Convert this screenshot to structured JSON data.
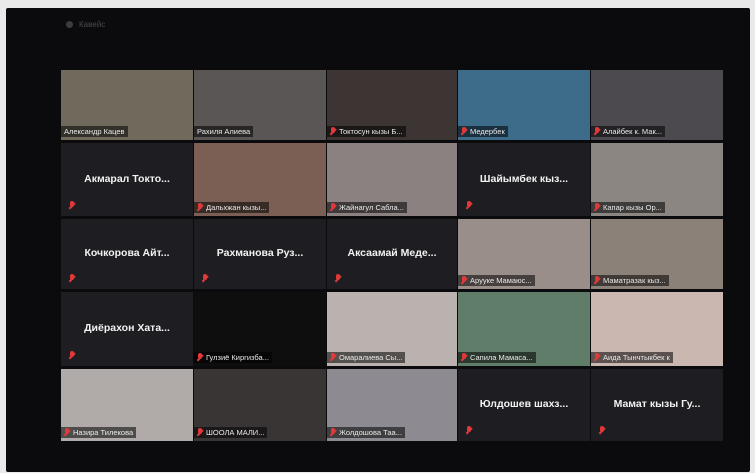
{
  "window": {
    "title": "Кавейс"
  },
  "participants": [
    {
      "name": "Александр Кацев",
      "video": true,
      "active": true,
      "bg": "#6f6a5c"
    },
    {
      "name": "Рахиля Алиева",
      "video": true,
      "bg": "#5b5656"
    },
    {
      "name": "Токтосун кызы Б...",
      "video": true,
      "muted": true,
      "bg": "#3c3534"
    },
    {
      "name": "Медербек",
      "video": true,
      "muted": true,
      "bg": "#3d6b8a"
    },
    {
      "name": "Алайбек к. Мак...",
      "video": true,
      "muted": true,
      "bg": "#4c4a4f"
    },
    {
      "name": "Акмарал Токто...",
      "video": false,
      "muted": true
    },
    {
      "name": "Дальхжан кызы...",
      "video": true,
      "muted": true,
      "bg": "#7b5f54"
    },
    {
      "name": "Жайнагул Сабла...",
      "video": true,
      "muted": true,
      "bg": "#8a8180"
    },
    {
      "name": "Шайымбек кыз...",
      "video": false,
      "muted": true
    },
    {
      "name": "Капар кызы Ор...",
      "video": true,
      "muted": true,
      "bg": "#8b8682"
    },
    {
      "name": "Кочкорова Айт...",
      "video": false,
      "muted": true
    },
    {
      "name": "Рахманова Руз...",
      "video": false,
      "muted": true
    },
    {
      "name": "Аксаамай Меде...",
      "video": false,
      "muted": true
    },
    {
      "name": "Арууке Мамаюс...",
      "video": true,
      "muted": true,
      "bg": "#9a8e8a"
    },
    {
      "name": "Маматразак кыз...",
      "video": true,
      "muted": true,
      "bg": "#8c8178"
    },
    {
      "name": "Диёрахон Хата...",
      "video": false,
      "muted": true
    },
    {
      "name": "Гулзиё Киргизба...",
      "video": true,
      "muted": true,
      "bg": "#0e0e0e"
    },
    {
      "name": "Омаралиева Сы...",
      "video": true,
      "muted": true,
      "bg": "#b9b2ae"
    },
    {
      "name": "Сапила Мамаса...",
      "video": true,
      "muted": true,
      "bg": "#5f7d68"
    },
    {
      "name": "Аида Тынчтыкбек к",
      "video": true,
      "muted": true,
      "bg": "#c9b7b0"
    },
    {
      "name": "Назира Тилекова",
      "video": true,
      "muted": true,
      "bg": "#b0aba8"
    },
    {
      "name": "ШООЛА МАЛИ...",
      "video": true,
      "muted": true,
      "bg": "#3a3535"
    },
    {
      "name": "Жолдошова Таа...",
      "video": true,
      "muted": true,
      "bg": "#8d8b91"
    },
    {
      "name": "Юлдошев шахз...",
      "video": false,
      "muted": true
    },
    {
      "name": "Мамат кызы Гу...",
      "video": false,
      "muted": true
    }
  ]
}
